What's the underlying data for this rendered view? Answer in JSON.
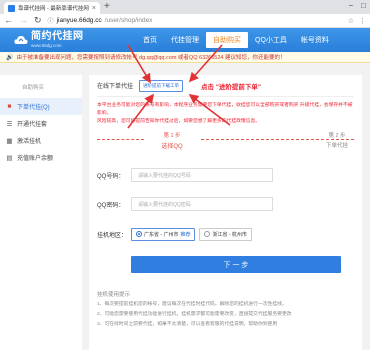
{
  "browser": {
    "tab_title": "靠谱代挂网 - 最新靠谱代挂网站",
    "url_domain": "jianyue.66dg.cc",
    "url_path": "/user/shop/index"
  },
  "site": {
    "logo_name": "简约代挂网",
    "logo_domain": "www.66dg.com"
  },
  "nav": [
    "首页",
    "代挂管理",
    "自助购买",
    "QQ小工具",
    "帐号资料"
  ],
  "notice": "由于被准备要出现问题，您需要按照到请修改帐号 dg.qq@qq.com 或者QQ 63266524 建议知您，你还能要的！",
  "sidebar": {
    "title": "自助购买",
    "items": [
      "下单代挂(Q)",
      "开通代挂套",
      "激活挂机",
      "充值账户余额"
    ]
  },
  "panel": {
    "title": "在线下单代挂",
    "download_btn": "进阶提前下载工单",
    "callout": "点击 \"进阶提前下单\"",
    "warning_1": "本平台业务可能对您的帐号有影响，本程序业务需要您下单代挂，收挂您可以全部购买或者购买 升级代挂，会保存并不被影响，",
    "warning_2": "风险较高，您可将提前告知你代挂过后，如要您想了解更多的代挂政策信息。"
  },
  "steps": {
    "step1_num": "第 1 步",
    "step1_label": "选择QQ",
    "step2_num": "第 2 步",
    "step2_label": "下单代挂"
  },
  "form": {
    "qq_label": "QQ号码：",
    "qq_placeholder": "请输入要代挂的QQ号码",
    "pwd_label": "QQ密码：",
    "pwd_placeholder": "请输入要代挂的QQ密码",
    "region_label": "挂机地区：",
    "region_option_1": "广东省 - 广州市",
    "region_option_1_tag": "推荐",
    "region_option_2": "浙江省 - 杭州市",
    "next_btn": "下 一 步"
  },
  "hints": {
    "title": "挂机使用提示",
    "lines": [
      "1、每次要提前挂机您的帐号，建议每次在代挂时挂代码，解除您的挂机进行一次性挂线。",
      "2、可能您需要使用代挂功能进行挂机，挂机需求都可能需要改变，直接提交代挂服务要更改",
      "3、可在线时间之前要代挂，如果不太清楚，可以查看客服的代挂说明，帮助你到使用"
    ]
  },
  "colors": {
    "header_blue": "#2a7fd9",
    "accent_orange": "#f08a24",
    "annotation_red": "#e23333",
    "button_blue": "#2f7ee0"
  }
}
